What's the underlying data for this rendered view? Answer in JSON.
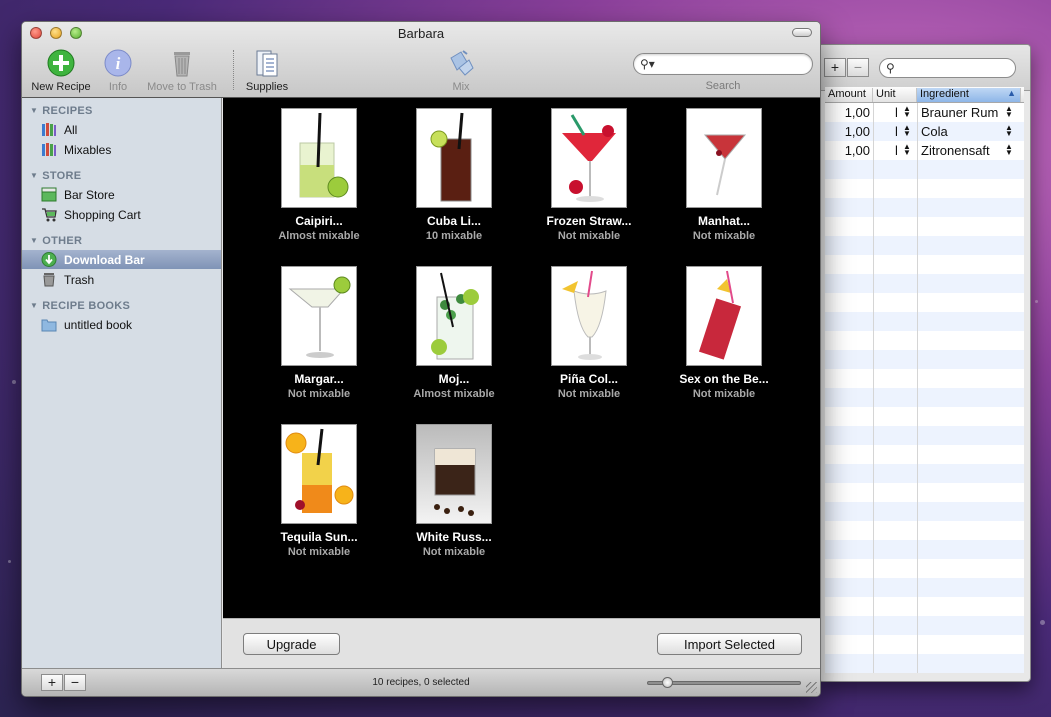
{
  "window": {
    "title": "Barbara"
  },
  "toolbar": {
    "new_recipe": "New Recipe",
    "info": "Info",
    "move_to_trash": "Move to Trash",
    "supplies": "Supplies",
    "mix": "Mix",
    "search_label": "Search",
    "search_value": "",
    "search_placeholder": ""
  },
  "sidebar": {
    "sections": [
      {
        "title": "RECIPES",
        "items": [
          {
            "label": "All",
            "icon": "books-icon"
          },
          {
            "label": "Mixables",
            "icon": "books-icon"
          }
        ]
      },
      {
        "title": "STORE",
        "items": [
          {
            "label": "Bar Store",
            "icon": "store-icon"
          },
          {
            "label": "Shopping Cart",
            "icon": "cart-icon"
          }
        ]
      },
      {
        "title": "OTHER",
        "items": [
          {
            "label": "Download Bar",
            "icon": "download-icon",
            "selected": true
          },
          {
            "label": "Trash",
            "icon": "trash-icon"
          }
        ]
      },
      {
        "title": "RECIPE BOOKS",
        "items": [
          {
            "label": "untitled book",
            "icon": "folder-icon"
          }
        ]
      }
    ]
  },
  "recipes": [
    {
      "name": "Caipiri...",
      "status": "Almost mixable"
    },
    {
      "name": "Cuba Li...",
      "status": "10 mixable"
    },
    {
      "name": "Frozen Straw...",
      "status": "Not mixable"
    },
    {
      "name": "Manhat...",
      "status": "Not mixable"
    },
    {
      "name": "Margar...",
      "status": "Not mixable"
    },
    {
      "name": "Moj...",
      "status": "Almost mixable"
    },
    {
      "name": "Piña Col...",
      "status": "Not mixable"
    },
    {
      "name": "Sex on the Be...",
      "status": "Not mixable"
    },
    {
      "name": "Tequila Sun...",
      "status": "Not mixable"
    },
    {
      "name": "White Russ...",
      "status": "Not mixable"
    }
  ],
  "actions": {
    "upgrade": "Upgrade",
    "import_selected": "Import Selected"
  },
  "statusbar": {
    "text": "10 recipes, 0 selected",
    "zoom_fraction": 0.13
  },
  "ingredients_panel": {
    "add_label": "+",
    "remove_label": "−",
    "columns": [
      "Amount",
      "Unit",
      "Ingredient"
    ],
    "rows": [
      {
        "amount": "1,00",
        "unit": "l",
        "ingredient": "Brauner Rum"
      },
      {
        "amount": "1,00",
        "unit": "l",
        "ingredient": "Cola"
      },
      {
        "amount": "1,00",
        "unit": "l",
        "ingredient": "Zitronensaft"
      }
    ]
  },
  "bottom_buttons": {
    "add": "+",
    "remove": "−"
  },
  "colors": {
    "accent": "#7f93b6",
    "content_bg": "#000000",
    "sidebar_bg": "#d6dde5"
  }
}
